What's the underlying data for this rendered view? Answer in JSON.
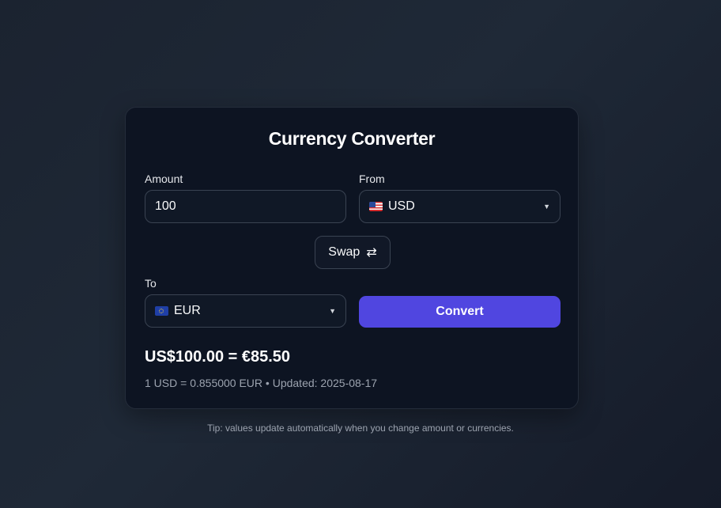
{
  "card": {
    "title": "Currency Converter"
  },
  "amount": {
    "label": "Amount",
    "value": "100"
  },
  "from": {
    "label": "From",
    "flag_icon": "us-flag-icon",
    "currency": "USD"
  },
  "swap": {
    "label": "Swap",
    "icon": "⇄"
  },
  "to": {
    "label": "To",
    "flag_icon": "eu-flag-icon",
    "currency": "EUR"
  },
  "convert": {
    "label": "Convert"
  },
  "result": {
    "main": "US$100.00 = €85.50",
    "rate_line": "1 USD = 0.855000 EUR • Updated: 2025-08-17"
  },
  "tip": "Tip: values update automatically when you change amount or currencies.",
  "colors": {
    "accent": "#5046e0",
    "card_bg": "#0d1422",
    "field_border": "#3a4352"
  }
}
